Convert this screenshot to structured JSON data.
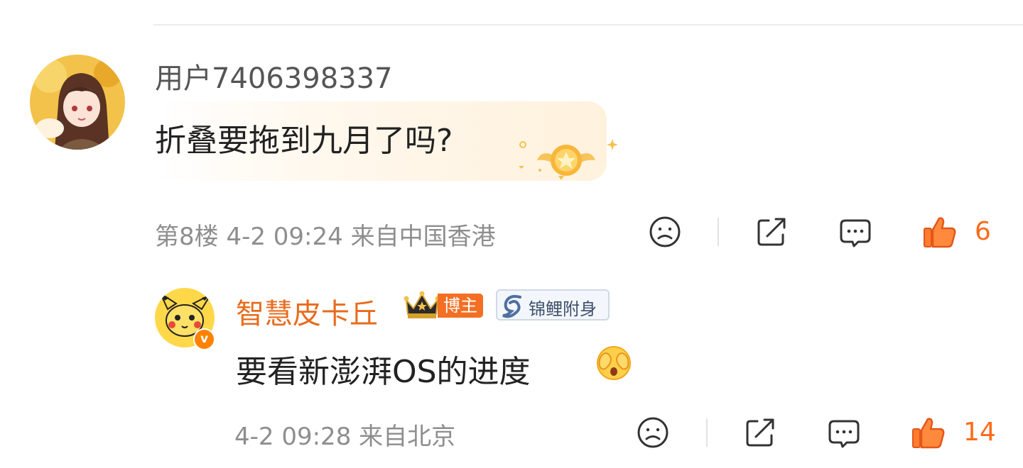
{
  "comment": {
    "username": "用户7406398337",
    "content": "折叠要拖到九月了吗?",
    "meta": "第8楼 4-2 09:24 来自中国香港",
    "like_count": "6"
  },
  "reply": {
    "username": "智慧皮卡丘",
    "blogger_badge": "博主",
    "koi_badge": "锦鲤附身",
    "content": "要看新澎湃OS的进度",
    "meta": "4-2 09:28 来自北京",
    "like_count": "14"
  },
  "icons": {
    "dislike": "frown-face-icon",
    "share": "share-icon",
    "comment": "comment-bubble-icon",
    "like": "thumbs-up-icon",
    "verified": "verified-v-icon",
    "crown": "crown-icon",
    "emoji": "hiding-face-emoji-icon"
  },
  "colors": {
    "accent": "#ff6a1a",
    "name_orange": "#e86b1d",
    "meta_gray": "#8e8e8e",
    "verified_orange": "#ff8200"
  }
}
